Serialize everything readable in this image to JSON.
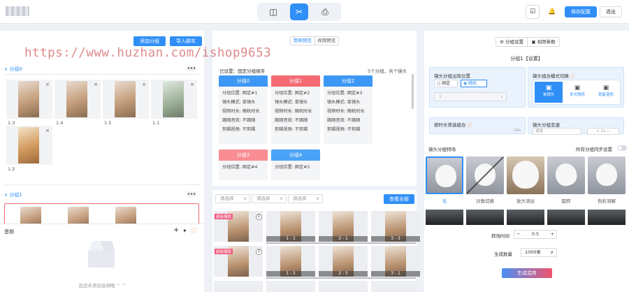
{
  "header": {
    "modes": [
      {
        "icon": "image-edit-icon"
      },
      {
        "icon": "scissors-icon",
        "active": true
      },
      {
        "icon": "video-printer-icon"
      }
    ],
    "save_label": "保存配置",
    "logout_label": "退出",
    "accent": "#2f8ff7"
  },
  "watermark": "https://www.huzhan.com/ishop9653",
  "left": {
    "add_group": "添加分组",
    "import_script": "导入脚本",
    "group0": {
      "title": "分组0",
      "items": [
        {
          "caption": "1.3"
        },
        {
          "caption": "1.4"
        },
        {
          "caption": "1.5"
        },
        {
          "caption": "1.1"
        },
        {
          "caption": "1.2"
        }
      ]
    },
    "group1": {
      "title": "分组1"
    },
    "audio": {
      "title": "音频",
      "empty_hint": "您还未添加音频哦 ^ ^"
    }
  },
  "middle": {
    "tabs": [
      "策略预览",
      "视频预览"
    ],
    "configured": "已设置：固定分组顺序",
    "summary": "5个分组，共个镜头",
    "cards": [
      {
        "title": "分组0",
        "color": "#3d98f5",
        "lines": [
          "分组位置: 固定#1",
          "镜头模式: 单镜头",
          "视频时长: 随机时长",
          "跳随音效: 不跳随",
          "剪辑视频: 不剪辑"
        ]
      },
      {
        "title": "分组1",
        "color": "#f46b73",
        "lines": [
          "分组位置: 固定#2",
          "镜头模式: 单镜头",
          "视频时长: 随机时长",
          "跳随音效: 不跳随",
          "剪辑视频: 不剪辑"
        ]
      },
      {
        "title": "分组2",
        "color": "#3d98f5",
        "lines": [
          "分组位置: 固定#3",
          "镜头模式: 单镜头",
          "视频时长: 随机时长",
          "跳随音效: 不跳随",
          "剪辑视频: 不剪辑"
        ]
      },
      {
        "title": "分组3",
        "color": "#f46b73",
        "lines": [
          "分组位置: 固定#4"
        ]
      },
      {
        "title": "分组4",
        "color": "#3d98f5",
        "lines": [
          "分组位置: 固定#5"
        ]
      }
    ],
    "filters": [
      "请选择",
      "请选择",
      "请选择"
    ],
    "view_all": "查看全部",
    "clip_badge": "超级爆款",
    "videos": [
      "1 - 1",
      "2 - 1",
      "3 - 3",
      "1 - 5",
      "2 - 5",
      "3 - 1"
    ]
  },
  "right": {
    "tabs": [
      "分组设置",
      "视频参数"
    ],
    "group_title": "分组1【设置】",
    "pos_label": "镜头分组出现位置",
    "pos_options": [
      "固定",
      "随机"
    ],
    "pos_value": "1",
    "mode_label": "镜头组合模式切换",
    "mode_options": [
      "单镜头",
      "多次随机",
      "智能混剪"
    ],
    "dur_label": "按时长筛选组合",
    "dur_value": "10s",
    "trans_label": "镜头分组变速",
    "trans_value": "1x",
    "trans_placeholder": "请选",
    "effects_label": "镜头分组特场",
    "sync_label": "所有分组同步设置",
    "effects": [
      "无",
      "对角切换",
      "放大溶出",
      "旋转",
      "色彩溶解"
    ],
    "transition_time_label": "转场时间",
    "transition_time": "0.5",
    "gen_count_label": "生成数量",
    "gen_count": "1000条",
    "generate_label": "生成混剪"
  }
}
